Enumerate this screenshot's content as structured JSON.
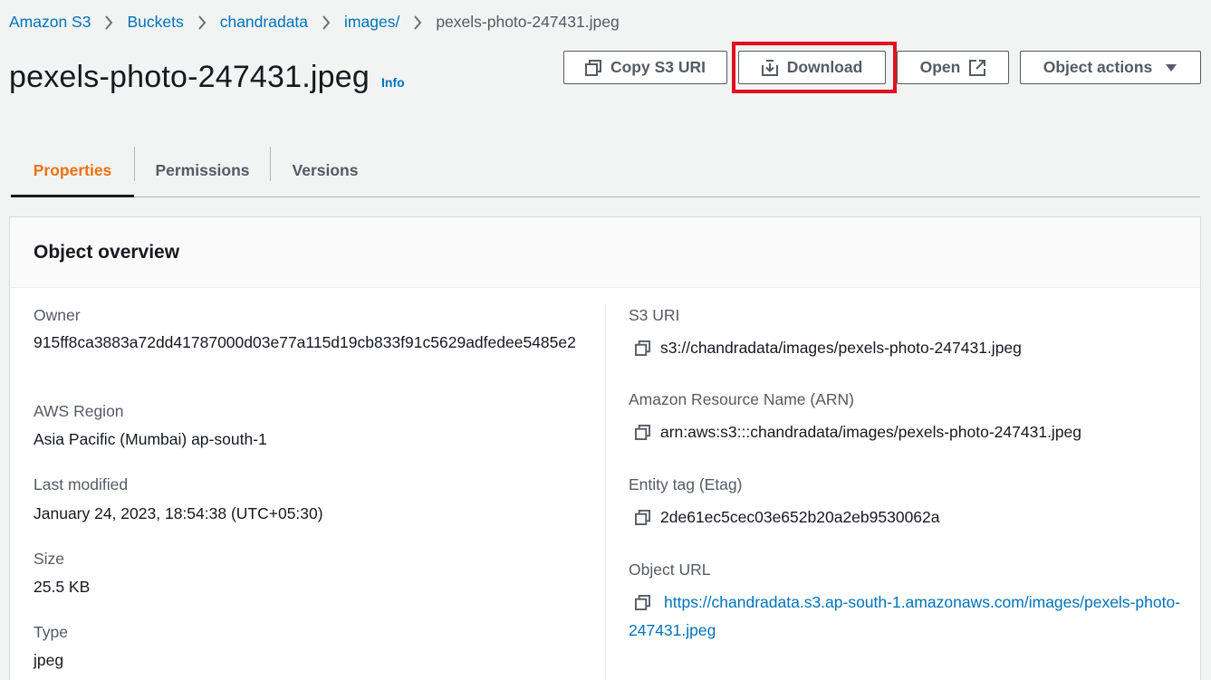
{
  "breadcrumb": {
    "items": [
      "Amazon S3",
      "Buckets",
      "chandradata",
      "images/"
    ],
    "current": "pexels-photo-247431.jpeg"
  },
  "header": {
    "title": "pexels-photo-247431.jpeg",
    "info_label": "Info"
  },
  "actions": {
    "copy_s3_uri": "Copy S3 URI",
    "download": "Download",
    "open": "Open",
    "object_actions": "Object actions"
  },
  "tabs": [
    {
      "label": "Properties",
      "active": true
    },
    {
      "label": "Permissions",
      "active": false
    },
    {
      "label": "Versions",
      "active": false
    }
  ],
  "overview": {
    "title": "Object overview",
    "owner_label": "Owner",
    "owner_value": "915ff8ca3883a72dd41787000d03e77a115d19cb833f91c5629adfedee5485e2",
    "region_label": "AWS Region",
    "region_value": "Asia Pacific (Mumbai) ap-south-1",
    "modified_label": "Last modified",
    "modified_value": "January 24, 2023, 18:54:38 (UTC+05:30)",
    "size_label": "Size",
    "size_value": "25.5 KB",
    "type_label": "Type",
    "type_value": "jpeg",
    "s3uri_label": "S3 URI",
    "s3uri_value": "s3://chandradata/images/pexels-photo-247431.jpeg",
    "arn_label": "Amazon Resource Name (ARN)",
    "arn_value": "arn:aws:s3:::chandradata/images/pexels-photo-247431.jpeg",
    "etag_label": "Entity tag (Etag)",
    "etag_value": "2de61ec5cec03e652b20a2eb9530062a",
    "url_label": "Object URL",
    "url_value": "https://chandradata.s3.ap-south-1.amazonaws.com/images/pexels-photo-247431.jpeg"
  },
  "colors": {
    "link": "#0073bb",
    "active_tab": "#ec7211",
    "highlight": "#e2101e",
    "background": "#f2f3f3"
  },
  "icons": [
    "chevron-right-icon",
    "copy-icon",
    "download-icon",
    "external-link-icon",
    "caret-down-icon"
  ]
}
